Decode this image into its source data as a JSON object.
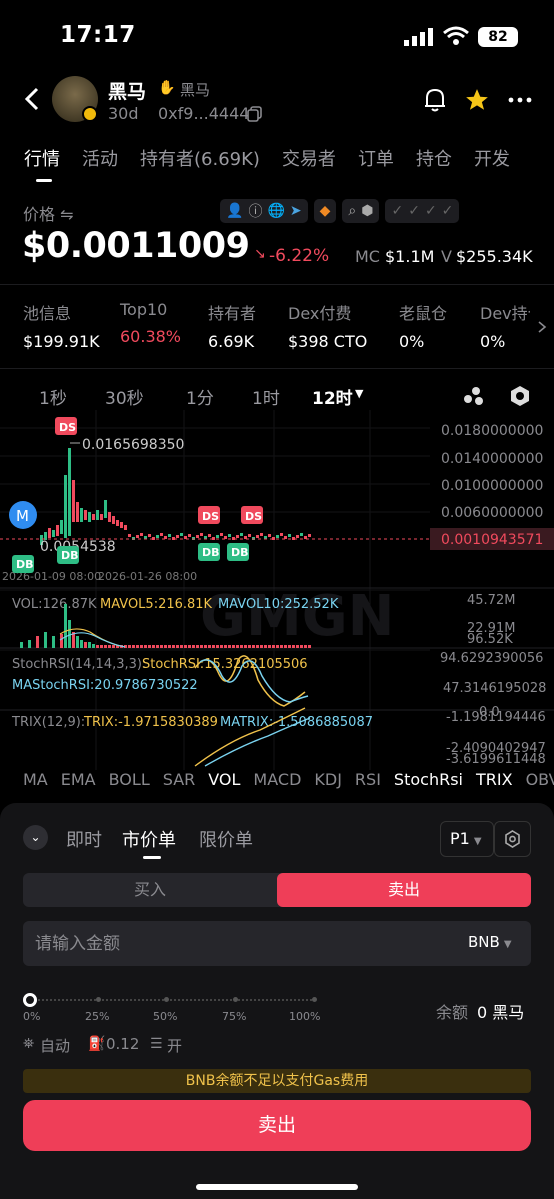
{
  "status": {
    "time": "17:17",
    "battery": "82"
  },
  "header": {
    "title": "黑马",
    "subtitle": "黑马",
    "age": "30d",
    "address": "0xf9...4444"
  },
  "tabs": [
    "行情",
    "活动",
    "持有者(6.69K)",
    "交易者",
    "订单",
    "持仓",
    "开发"
  ],
  "price": {
    "label": "价格 ⇋",
    "value": "$0.0011009",
    "change": "-6.22%",
    "mc_label": "MC",
    "mc_value": "$1.1M",
    "v_label": "V",
    "v_value": "$255.34K"
  },
  "stats": [
    {
      "label": "池信息",
      "value": "$199.91K"
    },
    {
      "label": "Top10",
      "value": "60.38%"
    },
    {
      "label": "持有者",
      "value": "6.69K"
    },
    {
      "label": "Dex付费",
      "value": "$398 CTO"
    },
    {
      "label": "老鼠仓",
      "value": "0%"
    },
    {
      "label": "Dev持仓",
      "value": "0%"
    }
  ],
  "timeframes": [
    "1秒",
    "30秒",
    "1分",
    "1时",
    "12时"
  ],
  "active_timeframe": "12时",
  "chart": {
    "high_label": "0.0165698350",
    "low_label": "0.0054538",
    "price_axis": [
      "0.0180000000",
      "0.0140000000",
      "0.0100000000",
      "0.0060000000"
    ],
    "current_price": "0.0010943571",
    "date_labels": [
      "2026-01-09 08:00",
      "2026-01-26 08:00"
    ],
    "markers": {
      "ds": "DS",
      "db": "DB",
      "m": "M"
    },
    "vol": {
      "label": "VOL:126.87K",
      "mavol5": "MAVOL5:216.81K",
      "mavol10": "MAVOL10:252.52K",
      "axis_top": "45.72M",
      "axis_mid": "22.91M",
      "axis_bottom": "96.52K"
    },
    "stochrsi": {
      "label": "StochRSI(14,14,3,3):",
      "value": "StochRSI:15.3262105506",
      "ma": "MAStochRSI:20.9786730522",
      "axis_top": "94.6292390056",
      "axis_mid": "47.3146195028",
      "axis_bottom": "0.0"
    },
    "trix": {
      "label": "TRIX(12,9):",
      "value": "TRIX:-1.9715830389",
      "ma": "MATRIX:-1.5086885087",
      "axis_top": "-1.1981194446",
      "axis_mid": "-2.4090402947",
      "axis_bottom": "-3.6199611448"
    }
  },
  "indicators": [
    "MA",
    "EMA",
    "BOLL",
    "SAR",
    "VOL",
    "MACD",
    "KDJ",
    "RSI",
    "StochRsi",
    "TRIX",
    "OBV"
  ],
  "order": {
    "tabs": [
      "即时",
      "市价单",
      "限价单"
    ],
    "preset": "P1",
    "buy": "买入",
    "sell": "卖出",
    "amount_placeholder": "请输入金额",
    "token": "BNB",
    "slider_marks": [
      "0%",
      "25%",
      "50%",
      "75%",
      "100%"
    ],
    "balance_label": "余额",
    "balance_value": "0 黑马",
    "auto": "自动",
    "gas": "0.12",
    "mev": "开",
    "warning": "BNB余额不足以支付Gas费用",
    "submit": "卖出"
  },
  "colors": {
    "up": "#2ebd85",
    "down": "#f04a5d",
    "accent": "#ef3e58",
    "warning": "#f0c24b"
  }
}
